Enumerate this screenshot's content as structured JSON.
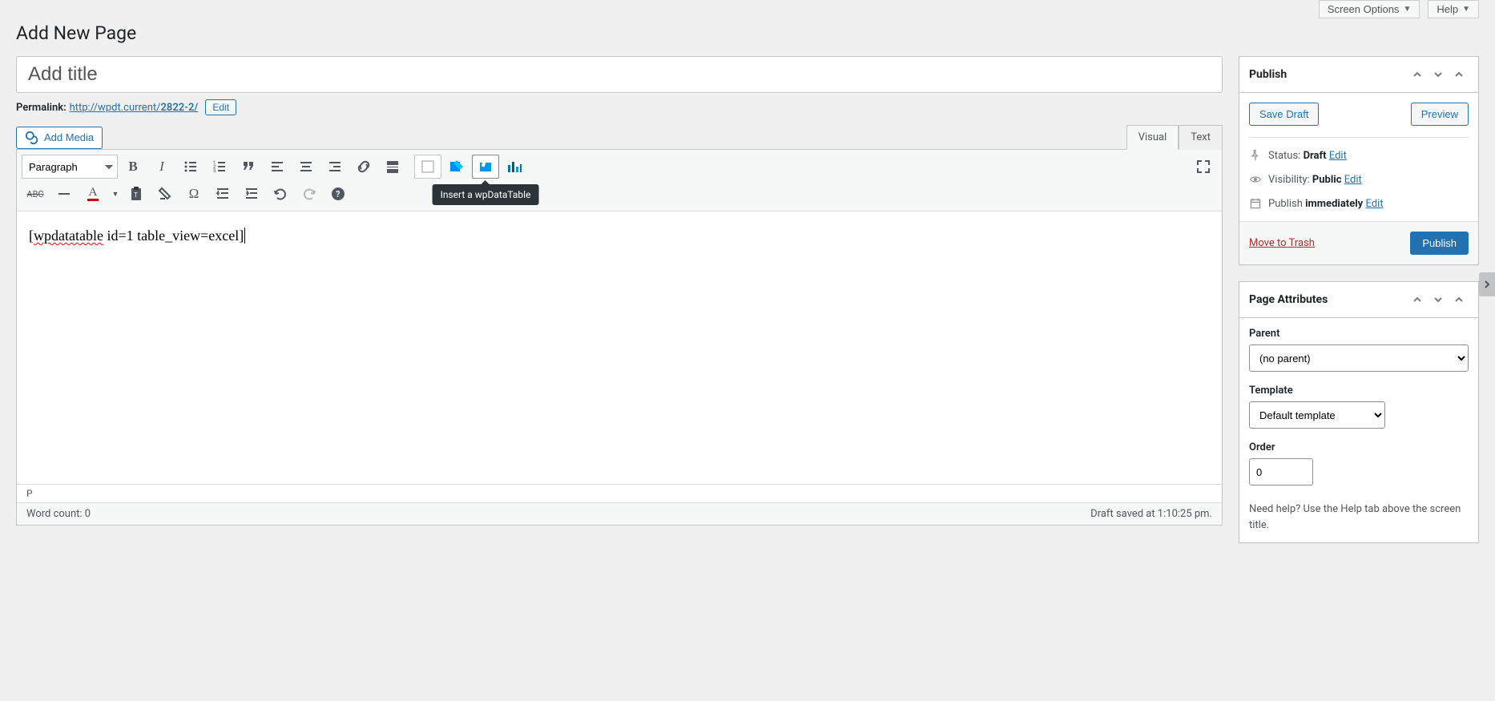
{
  "topbar": {
    "screen_options": "Screen Options",
    "help": "Help"
  },
  "page_heading": "Add New Page",
  "title_placeholder": "Add title",
  "permalink": {
    "label": "Permalink:",
    "base": "http://wpdt.current/",
    "slug": "2822-2/",
    "edit": "Edit"
  },
  "add_media": "Add Media",
  "tabs": {
    "visual": "Visual",
    "text": "Text"
  },
  "format_select": "Paragraph",
  "tooltip_text": "Insert a wpDataTable",
  "content_prefix_underlined": "wpdatatable",
  "content_rest": " id=1 table_view=excel]",
  "content_open": "[",
  "path_display": "P",
  "word_count_label": "Word count: ",
  "word_count_value": "0",
  "draft_saved": "Draft saved at 1:10:25 pm.",
  "publish": {
    "title": "Publish",
    "save_draft": "Save Draft",
    "preview": "Preview",
    "status_label": "Status:",
    "status_value": "Draft",
    "visibility_label": "Visibility:",
    "visibility_value": "Public",
    "publish_label": "Publish",
    "publish_value": "immediately",
    "edit": "Edit",
    "trash": "Move to Trash",
    "publish_btn": "Publish"
  },
  "attrs": {
    "title": "Page Attributes",
    "parent_label": "Parent",
    "parent_value": "(no parent)",
    "template_label": "Template",
    "template_value": "Default template",
    "order_label": "Order",
    "order_value": "0",
    "help_text": "Need help? Use the Help tab above the screen title."
  }
}
